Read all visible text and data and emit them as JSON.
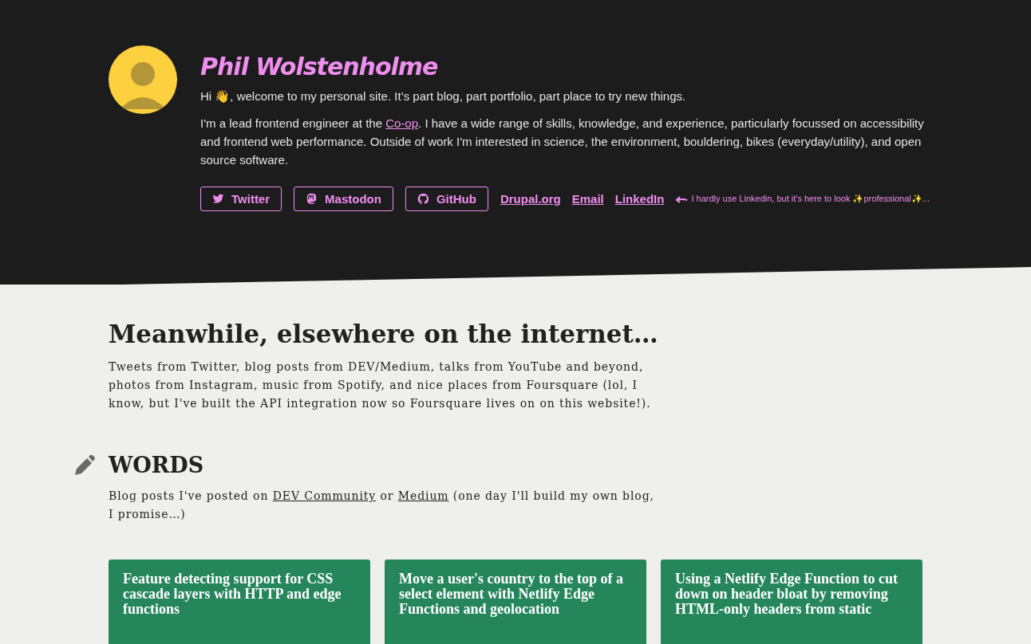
{
  "header": {
    "name": "Phil Wolstenholme",
    "intro": "Hi 👋, welcome to my personal site. It’s part blog, part portfolio, part place to try new things.",
    "bio": {
      "before": "I'm a lead frontend engineer at the ",
      "link": "Co-op",
      "after": ". I have a wide range of skills, knowledge, and experience, particularly focussed on accessibility and frontend web performance. Outside of work I'm interested in science, the environment, bouldering, bikes (everyday/utility), and open source software."
    },
    "links": [
      {
        "kind": "twitter",
        "label": "Twitter"
      },
      {
        "kind": "mastodon",
        "label": "Mastodon"
      },
      {
        "kind": "github",
        "label": "GitHub"
      },
      {
        "kind": "link",
        "label": "Drupal.org"
      },
      {
        "kind": "link",
        "label": "Email"
      },
      {
        "kind": "link",
        "label": "LinkedIn"
      }
    ],
    "aside": "I hardly use Linkedin, but it's here to look ✨professional✨..."
  },
  "elsewhere": {
    "title": "Meanwhile, elsewhere on the internet…",
    "text": "Tweets from Twitter, blog posts from DEV/Medium, talks from YouTube and beyond, photos from Instagram, music from Spotify, and nice places from Foursquare (lol, I know, but I've built the API integration now so Foursquare lives on on this website!)."
  },
  "words": {
    "title": "WORDS",
    "text": {
      "before": "Blog posts I've posted on ",
      "link1": "DEV Community",
      "middle": " or ",
      "link2": "Medium",
      "after": " (one day I'll build my own blog, I promise…)"
    },
    "posts": [
      {
        "title": "Feature detecting support for CSS cascade layers with HTTP and edge functions"
      },
      {
        "title": "Move a user's country to the top of a select element with Netlify Edge Functions and geolocation"
      },
      {
        "title": "Using a Netlify Edge Function to cut down on header bloat by removing HTML-only headers from static"
      }
    ]
  }
}
